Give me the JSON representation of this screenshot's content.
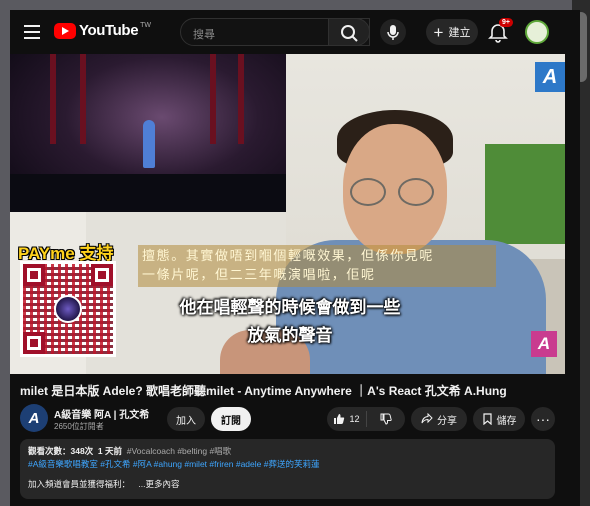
{
  "header": {
    "logo_text": "YouTube",
    "logo_country": "TW",
    "search_placeholder": "搜尋",
    "create_label": "建立",
    "notification_count": "9+"
  },
  "video": {
    "payme_title": "PAYme 支持",
    "subtitle_cantonese_line1": "擅態。其實做唔到嗰個輕嘅效果，但係你見呢",
    "subtitle_cantonese_line2": "一條片呢，但二三年嘅演唱啦，佢呢",
    "subtitle_mandarin_line1": "他在唱輕聲的時候會做到一些",
    "subtitle_mandarin_line2": "放氣的聲音",
    "corner_logo": "A"
  },
  "info": {
    "title": "milet 是日本版 Adele? 歌唱老師聽milet - Anytime Anywhere ｜A's React 孔文希 A.Hung",
    "channel_name": "A級音樂 阿A | 孔文希",
    "subscribers": "2650位訂閱者",
    "avatar_letter": "A",
    "join_label": "加入",
    "subscribe_label": "訂閱",
    "like_count": "12",
    "share_label": "分享",
    "save_label": "儲存",
    "more_label": "···"
  },
  "description": {
    "views": "觀看次數：348次",
    "date": "1 天前",
    "hashtags_line1": "#Vocalcoach #belting #唱歌",
    "hashtags_line2": "#A級音樂歌唱教室 #孔文希 #阿A #ahung #milet #friren #adele #葬送的芙莉蓮",
    "join_perks": "加入頻道會員並獲得福利：",
    "more_content": "...更多內容"
  },
  "colors": {
    "accent_red": "#ff0000",
    "link_blue": "#3ea6ff",
    "background": "#0f0f0f"
  }
}
